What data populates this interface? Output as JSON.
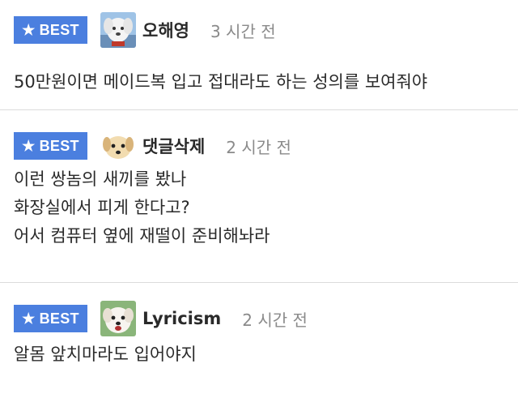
{
  "comments": [
    {
      "badge": "BEST",
      "avatar_icon": "white-dog-avatar",
      "nickname": "오해영",
      "time": "3 시간 전",
      "lines": [
        "50만원이면 메이드복 입고 접대라도 하는 성의를 보여줘야"
      ]
    },
    {
      "badge": "BEST",
      "avatar_icon": "cartoon-dog-avatar",
      "nickname": "댓글삭제",
      "time": "2 시간 전",
      "lines": [
        "이런 쌍놈의 새끼를 봤나",
        "화장실에서 피게 한다고?",
        "어서 컴퓨터 옆에 재떨이 준비해놔라"
      ]
    },
    {
      "badge": "BEST",
      "avatar_icon": "puppy-avatar",
      "nickname": "Lyricism",
      "time": "2 시간 전",
      "lines": [
        "알몸 앞치마라도 입어야지"
      ]
    }
  ],
  "colors": {
    "badge_bg": "#4b7fdf",
    "badge_text": "#ffffff",
    "time_text": "#8a8a8a",
    "divider": "#dcdcdc"
  },
  "icons": {
    "badge_icon": "star-icon"
  }
}
